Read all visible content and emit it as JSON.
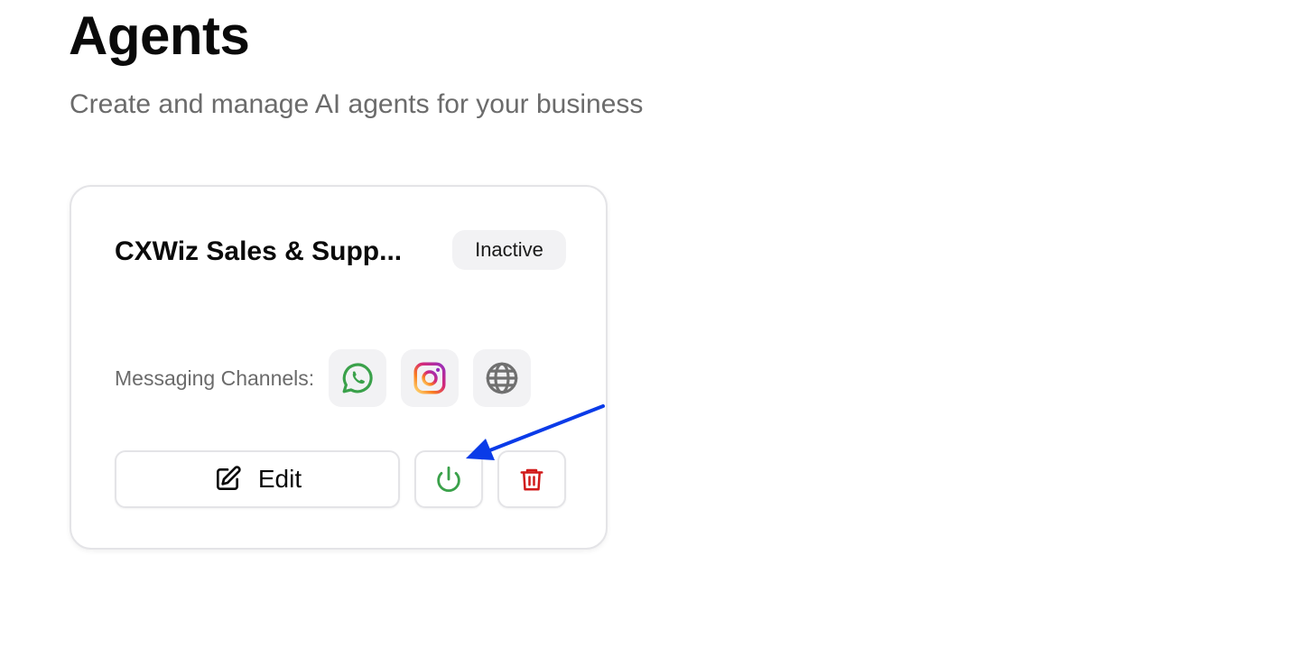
{
  "header": {
    "title": "Agents",
    "subtitle": "Create and manage AI agents for your business"
  },
  "agent_card": {
    "name": "CXWiz Sales & Supp...",
    "status": "Inactive",
    "channels_label": "Messaging Channels:",
    "channels": [
      {
        "icon": "whatsapp-icon",
        "color": "#3aa14a"
      },
      {
        "icon": "instagram-icon",
        "color": "#d6249f"
      },
      {
        "icon": "globe-icon",
        "color": "#707070"
      }
    ],
    "edit_label": "Edit",
    "power_icon_color": "#3aa14a",
    "delete_icon_color": "#d11a1a"
  },
  "annotation": {
    "arrow_color": "#0a3be8"
  }
}
